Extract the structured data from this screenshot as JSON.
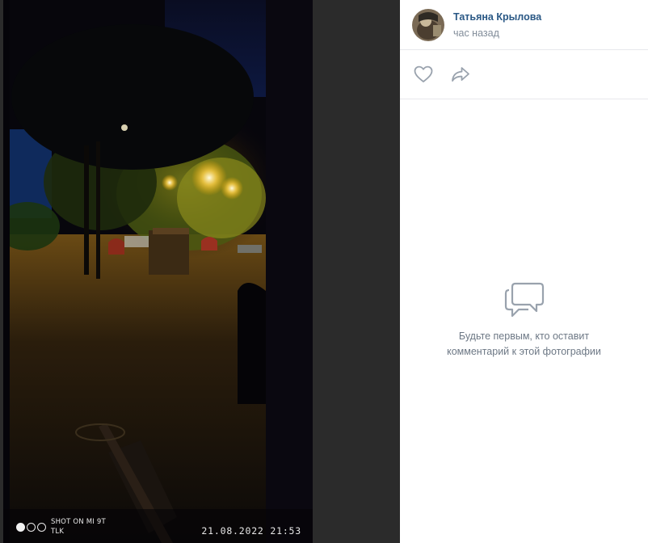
{
  "photo": {
    "watermark_line1": "SHOT ON MI 9T",
    "watermark_line2": "TLK",
    "timestamp": "21.08.2022 21:53"
  },
  "author": {
    "name": "Татьяна Крылова",
    "time": "час назад"
  },
  "actions": {
    "like_icon": "heart-icon",
    "share_icon": "share-arrow-icon"
  },
  "comments": {
    "empty_line1": "Будьте первым, кто оставит",
    "empty_line2": "комментарий к этой фотографии",
    "icon": "speech-bubbles-icon"
  },
  "colors": {
    "link": "#2a5885",
    "secondary": "#818c99",
    "icon": "#99a2ad"
  }
}
